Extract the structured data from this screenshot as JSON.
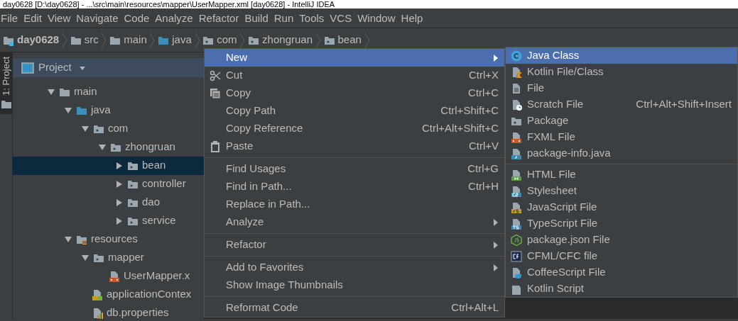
{
  "title_bar": {
    "title": "day0628 [D:\\day0628] - ...\\src\\main\\resources\\mapper\\UserMapper.xml [day0628] - IntelliJ IDEA"
  },
  "menu_bar": [
    "File",
    "Edit",
    "View",
    "Navigate",
    "Code",
    "Analyze",
    "Refactor",
    "Build",
    "Run",
    "Tools",
    "VCS",
    "Window",
    "Help"
  ],
  "breadcrumb": [
    {
      "label": "day0628",
      "kind": "module"
    },
    {
      "label": "src",
      "kind": "folder"
    },
    {
      "label": "main",
      "kind": "folder"
    },
    {
      "label": "java",
      "kind": "source"
    },
    {
      "label": "com",
      "kind": "package"
    },
    {
      "label": "zhongruan",
      "kind": "package"
    },
    {
      "label": "bean",
      "kind": "package"
    }
  ],
  "tool_stripe": {
    "label": "1: Project"
  },
  "project_panel": {
    "title": "Project",
    "tree": [
      {
        "label": "main",
        "kind": "folder",
        "expanded": true,
        "selected": false,
        "children": [
          {
            "label": "java",
            "kind": "source",
            "expanded": true,
            "selected": false,
            "children": [
              {
                "label": "com",
                "kind": "package",
                "expanded": true,
                "selected": false,
                "children": [
                  {
                    "label": "zhongruan",
                    "kind": "package",
                    "expanded": true,
                    "selected": false,
                    "children": [
                      {
                        "label": "bean",
                        "kind": "package",
                        "expanded": false,
                        "selected": true
                      },
                      {
                        "label": "controller",
                        "kind": "package",
                        "expanded": false,
                        "selected": false
                      },
                      {
                        "label": "dao",
                        "kind": "package",
                        "expanded": false,
                        "selected": false
                      },
                      {
                        "label": "service",
                        "kind": "package",
                        "expanded": false,
                        "selected": false
                      }
                    ]
                  }
                ]
              }
            ]
          },
          {
            "label": "resources",
            "kind": "resources",
            "expanded": true,
            "selected": false,
            "children": [
              {
                "label": "mapper",
                "kind": "package",
                "expanded": true,
                "selected": false,
                "children": [
                  {
                    "label": "UserMapper.x",
                    "kind": "xml",
                    "selected": false
                  }
                ]
              },
              {
                "label": "applicationContex",
                "kind": "spring",
                "selected": false
              },
              {
                "label": "db.properties",
                "kind": "properties",
                "selected": false
              }
            ]
          }
        ]
      }
    ]
  },
  "context_menu": {
    "items": [
      {
        "kind": "plain",
        "label": "New",
        "selected": true,
        "submenu": true
      },
      {
        "kind": "cut",
        "label": "Cut",
        "shortcut": "Ctrl+X",
        "selected": false,
        "submenu": false
      },
      {
        "kind": "copy",
        "label": "Copy",
        "shortcut": "Ctrl+C",
        "selected": false,
        "submenu": false
      },
      {
        "kind": "plain",
        "label": "Copy Path",
        "shortcut": "Ctrl+Shift+C",
        "selected": false,
        "submenu": false
      },
      {
        "kind": "plain",
        "label": "Copy Reference",
        "shortcut": "Ctrl+Alt+Shift+C",
        "selected": false,
        "submenu": false
      },
      {
        "kind": "paste",
        "label": "Paste",
        "shortcut": "Ctrl+V",
        "selected": false,
        "submenu": false
      },
      {
        "kind": "separator"
      },
      {
        "kind": "plain",
        "label": "Find Usages",
        "shortcut": "Ctrl+G",
        "selected": false,
        "submenu": false
      },
      {
        "kind": "plain",
        "label": "Find in Path...",
        "shortcut": "Ctrl+H",
        "selected": false,
        "submenu": false
      },
      {
        "kind": "plain",
        "label": "Replace in Path...",
        "selected": false,
        "submenu": false
      },
      {
        "kind": "plain",
        "label": "Analyze",
        "selected": false,
        "submenu": true
      },
      {
        "kind": "separator"
      },
      {
        "kind": "plain",
        "label": "Refactor",
        "selected": false,
        "submenu": true
      },
      {
        "kind": "separator"
      },
      {
        "kind": "plain",
        "label": "Add to Favorites",
        "selected": false,
        "submenu": true
      },
      {
        "kind": "plain",
        "label": "Show Image Thumbnails",
        "selected": false,
        "submenu": false
      },
      {
        "kind": "separator"
      },
      {
        "kind": "plain",
        "label": "Reformat Code",
        "shortcut": "Ctrl+Alt+L",
        "selected": false,
        "submenu": false
      }
    ]
  },
  "new_submenu": {
    "items": [
      {
        "kind": "class",
        "label": "Java Class",
        "selected": true
      },
      {
        "kind": "kotlin",
        "label": "Kotlin File/Class",
        "selected": false
      },
      {
        "kind": "file",
        "label": "File",
        "selected": false
      },
      {
        "kind": "scratch",
        "label": "Scratch File",
        "shortcut": "Ctrl+Alt+Shift+Insert",
        "selected": false
      },
      {
        "kind": "package",
        "label": "Package",
        "selected": false
      },
      {
        "kind": "xml",
        "label": "FXML File",
        "selected": false
      },
      {
        "kind": "javafile",
        "label": "package-info.java",
        "selected": false
      },
      {
        "kind": "separator"
      },
      {
        "kind": "html",
        "label": "HTML File",
        "selected": false
      },
      {
        "kind": "css",
        "label": "Stylesheet",
        "selected": false
      },
      {
        "kind": "js",
        "label": "JavaScript File",
        "selected": false
      },
      {
        "kind": "ts",
        "label": "TypeScript File",
        "selected": false
      },
      {
        "kind": "node",
        "label": "package.json File",
        "selected": false
      },
      {
        "kind": "cf",
        "label": "CFML/CFC file",
        "selected": false
      },
      {
        "kind": "coffee",
        "label": "CoffeeScript File",
        "selected": false
      },
      {
        "kind": "kts",
        "label": "Kotlin Script",
        "selected": false
      }
    ]
  }
}
